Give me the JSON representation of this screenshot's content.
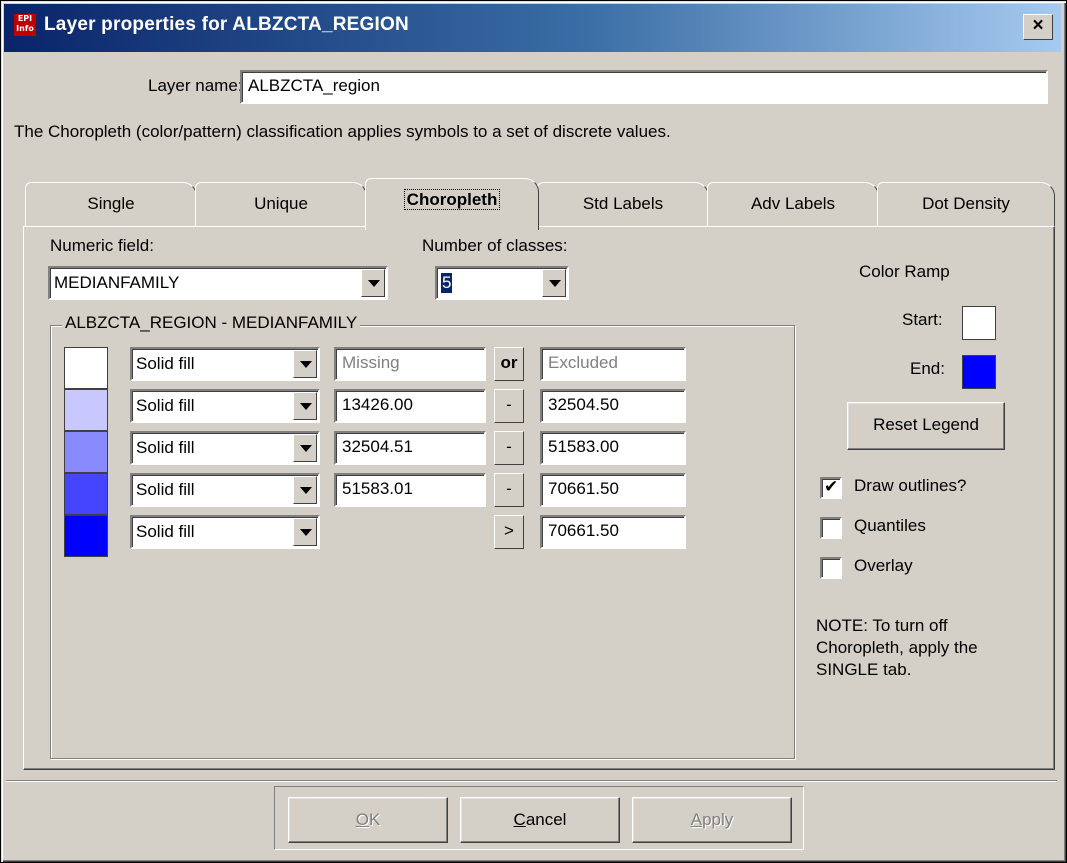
{
  "window": {
    "title": "Layer properties for ALBZCTA_REGION",
    "close_glyph": "×",
    "app_icon": "EpiInfo-icon"
  },
  "layer_name": {
    "label": "Layer name:",
    "value": "ALBZCTA_region"
  },
  "description": "The Choropleth (color/pattern) classification applies symbols to a set of discrete values.",
  "tabs": [
    {
      "label": "Single"
    },
    {
      "label": "Unique"
    },
    {
      "label": "Choropleth",
      "active": true
    },
    {
      "label": "Std Labels"
    },
    {
      "label": "Adv Labels"
    },
    {
      "label": "Dot Density"
    }
  ],
  "numeric_field": {
    "label": "Numeric field:",
    "value": "MEDIANFAMILY"
  },
  "num_classes": {
    "label": "Number of classes:",
    "value": "5"
  },
  "group_title": "ALBZCTA_REGION - MEDIANFAMILY",
  "classes": [
    {
      "color": "#ffffff",
      "fill": "Solid fill",
      "from": "Missing",
      "op": "or",
      "to": "Excluded",
      "disabled": true
    },
    {
      "color": "#c8c8ff",
      "fill": "Solid fill",
      "from": "13426.00",
      "op": "-",
      "to": "32504.50"
    },
    {
      "color": "#8a8aff",
      "fill": "Solid fill",
      "from": "32504.51",
      "op": "-",
      "to": "51583.00"
    },
    {
      "color": "#4545ff",
      "fill": "Solid fill",
      "from": "51583.01",
      "op": "-",
      "to": "70661.50"
    },
    {
      "color": "#0000ff",
      "fill": "Solid fill",
      "from": "",
      "op": ">",
      "to": "70661.50"
    }
  ],
  "color_ramp": {
    "title": "Color Ramp",
    "start_label": "Start:",
    "start_color": "#ffffff",
    "end_label": "End:",
    "end_color": "#0000ff"
  },
  "reset_legend": "Reset Legend",
  "options": [
    {
      "label": "Draw outlines?",
      "checked": true
    },
    {
      "label": "Quantiles",
      "checked": false
    },
    {
      "label": "Overlay",
      "checked": false
    }
  ],
  "note": [
    "NOTE: To turn off",
    "Choropleth, apply the",
    "SINGLE tab."
  ],
  "buttons": {
    "ok": {
      "u": "O",
      "rest": "K"
    },
    "cancel": {
      "u": "C",
      "rest": "ancel"
    },
    "apply": {
      "u": "A",
      "rest": "pply"
    }
  }
}
